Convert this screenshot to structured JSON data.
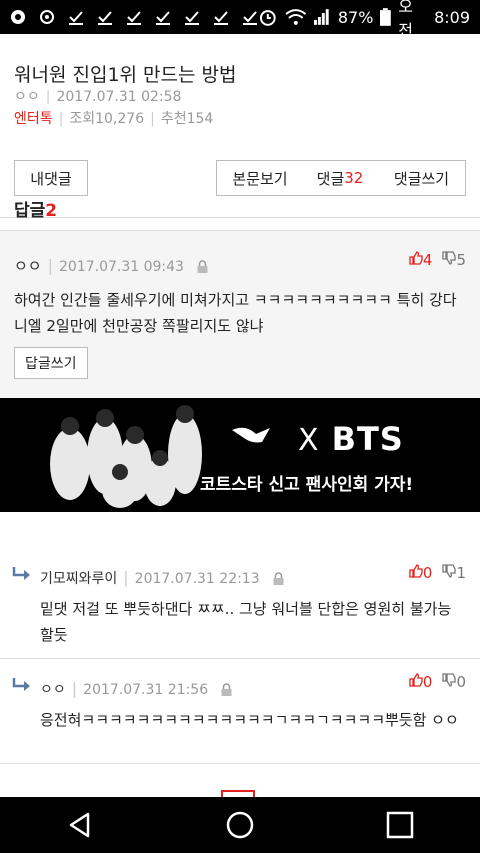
{
  "status": {
    "battery": "87%",
    "ampm": "오전",
    "time": "8:09"
  },
  "article": {
    "title": "워너원 진입1위 만드는 방법",
    "author": "ㅇㅇ",
    "date": "2017.07.31 02:58",
    "category": "엔터톡",
    "views": "조회10,276",
    "recommends": "추천154"
  },
  "buttons": {
    "my_comments": "내댓글",
    "view_body": "본문보기",
    "comments_label": "댓글",
    "comments_count": "32",
    "write_comment": "댓글쓰기"
  },
  "replies": {
    "label": "답글",
    "count": "2"
  },
  "main_comment": {
    "author": "ㅇㅇ",
    "date": "2017.07.31 09:43",
    "up": "4",
    "down": "5",
    "body": "하여간 인간들 줄세우기에 미쳐가지고 ㅋㅋㅋㅋㅋㅋㅋㅋㅋㅋ 특히 강다니엘 2일만에 천만공장 쪽팔리지도 않냐",
    "reply_button": "답글쓰기"
  },
  "ad": {
    "brand": "PUMA",
    "x": "X",
    "bts": "BTS",
    "tagline": "코트스타 신고 팬사인회 가자!"
  },
  "reply1": {
    "author": "기모찌와루이",
    "date": "2017.07.31 22:13",
    "up": "0",
    "down": "1",
    "body": "밑댓 저걸 또 뿌듯하댄다 ㅉㅉ.. 그냥 워너블 단합은 영원히 불가능할듯"
  },
  "reply2": {
    "author": "ㅇㅇ",
    "date": "2017.07.31 21:56",
    "up": "0",
    "down": "0",
    "body": "응전혀ㅋㅋㅋㅋㅋㅋㅋㅋㅋㅋㅋㅋㅋㅋㄱㅋㅋㄱㅋㅋㅋㅋ뿌듯함 ㅇㅇ"
  }
}
